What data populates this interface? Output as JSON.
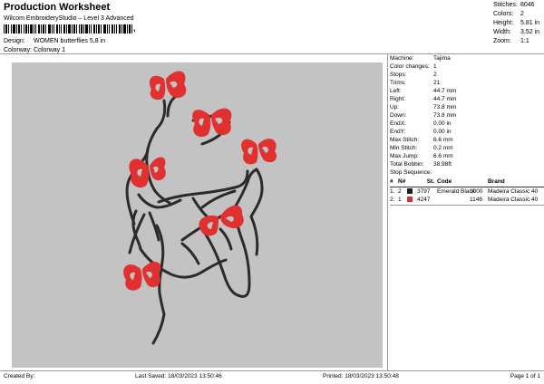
{
  "header": {
    "title": "Production Worksheet",
    "subtitle": "Wilcom EmbroideryStudio – Level 3 Advanced",
    "barcode_tail": ","
  },
  "stats": [
    {
      "label": "Stitches:",
      "value": "8046"
    },
    {
      "label": "Colors:",
      "value": "2"
    },
    {
      "label": "Height:",
      "value": "5.81 in"
    },
    {
      "label": "Width:",
      "value": "3.52 in"
    },
    {
      "label": "Zoom:",
      "value": "1:1"
    }
  ],
  "info": [
    {
      "label": "Design:",
      "value": "WOMEN butterflies 5,8 in"
    },
    {
      "label": "Colorway:",
      "value": "Colorway 1"
    }
  ],
  "params": [
    {
      "label": "Machine:",
      "value": "Tajima"
    },
    {
      "label": "Color changes:",
      "value": "1"
    },
    {
      "label": "Stops:",
      "value": "2"
    },
    {
      "label": "Trims:",
      "value": "21"
    },
    {
      "label": "Left:",
      "value": "44.7 mm"
    },
    {
      "label": "Right:",
      "value": "44.7 mm"
    },
    {
      "label": "Up:",
      "value": "73.8 mm"
    },
    {
      "label": "Down:",
      "value": "73.8 mm"
    },
    {
      "label": "EndX:",
      "value": "0.00 in"
    },
    {
      "label": "EndY:",
      "value": "0.00 in"
    },
    {
      "label": "Max Stitch:",
      "value": "6.6 mm"
    },
    {
      "label": "Min Stitch:",
      "value": "0.2 mm"
    },
    {
      "label": "Max Jump:",
      "value": "6.6 mm"
    },
    {
      "label": "Total Bobbin:",
      "value": "38.98ft"
    }
  ],
  "stop_sequence": {
    "title": "Stop Sequence:",
    "columns": [
      "#",
      "N#",
      "",
      "St.",
      "Code",
      "Brand"
    ],
    "rows": [
      {
        "num": "1.",
        "needle": "2",
        "color": "#1e1e1e",
        "code_id": "3797",
        "name": "Emerald Black",
        "stitches": "1000",
        "brand": "Madeira Classic 40"
      },
      {
        "num": "2.",
        "needle": "1",
        "color": "#e03030",
        "code_id": "4247",
        "name": "",
        "stitches": "1146",
        "brand": "Madeira Classic 40"
      }
    ]
  },
  "footer": {
    "created_by": "Created By:",
    "last_saved": "Last Saved: 18/03/2023 13:50:46",
    "printed": "Printed: 18/03/2023 13:50:48",
    "page": "Page 1 of 1"
  },
  "colors": {
    "canvas_bg": "#c3c3c3",
    "thread_dark": "#2b2b2b",
    "thread_red": "#e03030"
  }
}
